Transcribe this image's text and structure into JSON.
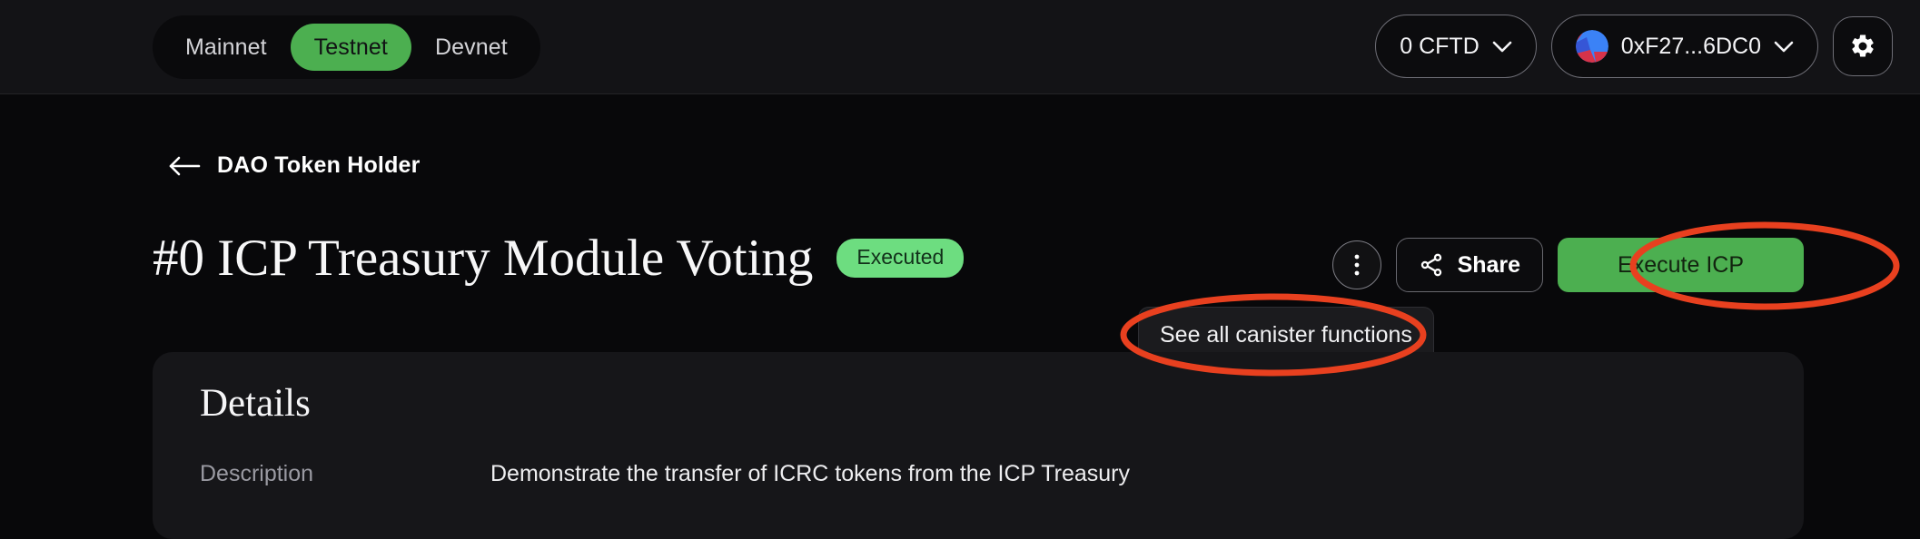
{
  "theme": {
    "page_bg": "#08080a",
    "topbar_bg": "#131316",
    "card_bg": "#161619",
    "accent_green": "#4caf50",
    "badge_green": "#6ddd80",
    "annotation_red": "#e8401f",
    "muted_text": "#9a9aa2"
  },
  "topbar": {
    "network_switch": {
      "options": [
        "Mainnet",
        "Testnet",
        "Devnet"
      ],
      "selected": "Testnet"
    },
    "balance": {
      "label": "0 CFTD",
      "chevron_icon": "chevron-down-icon"
    },
    "wallet": {
      "address": "0xF27...6DC0",
      "avatar_icon": "wallet-avatar-identicon",
      "chevron_icon": "chevron-down-icon"
    },
    "settings": {
      "icon": "gear-icon"
    }
  },
  "back_link": {
    "icon": "arrow-left-icon",
    "label": "DAO Token Holder"
  },
  "header": {
    "title": "#0 ICP Treasury Module Voting",
    "status_badge": "Executed"
  },
  "actions": {
    "more_menu_icon": "kebab-menu-icon",
    "share": {
      "icon": "share-nodes-icon",
      "label": "Share"
    },
    "execute": {
      "label": "Execute ICP"
    }
  },
  "tooltip": {
    "text": "See all canister functions"
  },
  "details_card": {
    "title": "Details",
    "rows": [
      {
        "label": "Description",
        "value": "Demonstrate the transfer of ICRC tokens from the ICP Treasury"
      }
    ]
  },
  "annotations": [
    {
      "name": "execute-button-highlight",
      "shape": "ellipse",
      "color": "#e8401f"
    },
    {
      "name": "tooltip-highlight",
      "shape": "ellipse",
      "color": "#e8401f"
    }
  ]
}
